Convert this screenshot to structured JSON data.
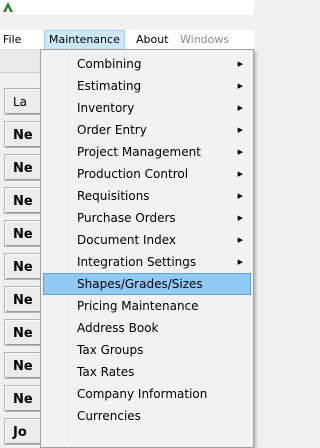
{
  "menubar": {
    "items": [
      {
        "label": "File",
        "state": "normal"
      },
      {
        "label": "Maintenance",
        "state": "open"
      },
      {
        "label": "About",
        "state": "normal"
      },
      {
        "label": "Windows",
        "state": "disabled"
      }
    ]
  },
  "background_buttons": [
    "La",
    "Ne",
    "Ne",
    "Ne",
    "Ne",
    "Ne",
    "Ne",
    "Ne",
    "Ne",
    "Ne",
    "Jo"
  ],
  "maintenance_menu": {
    "items": [
      {
        "label": "Combining",
        "submenu": true
      },
      {
        "label": "Estimating",
        "submenu": true
      },
      {
        "label": "Inventory",
        "submenu": true
      },
      {
        "label": "Order Entry",
        "submenu": true
      },
      {
        "label": "Project Management",
        "submenu": true
      },
      {
        "label": "Production Control",
        "submenu": true
      },
      {
        "label": "Requisitions",
        "submenu": true
      },
      {
        "label": "Purchase Orders",
        "submenu": true
      },
      {
        "label": "Document Index",
        "submenu": true
      },
      {
        "label": "Integration Settings",
        "submenu": true
      },
      {
        "label": "Shapes/Grades/Sizes",
        "submenu": false,
        "highlighted": true
      },
      {
        "label": "Pricing Maintenance",
        "submenu": false
      },
      {
        "label": "Address Book",
        "submenu": false
      },
      {
        "label": "Tax Groups",
        "submenu": false
      },
      {
        "label": "Tax Rates",
        "submenu": false
      },
      {
        "label": "Company Information",
        "submenu": false
      },
      {
        "label": "Currencies",
        "submenu": false
      }
    ],
    "submenu_arrow": "▶"
  },
  "colors": {
    "highlight": "#91c9f7",
    "menu_open": "#cce8ff",
    "icon_green": "#2e7d32"
  }
}
